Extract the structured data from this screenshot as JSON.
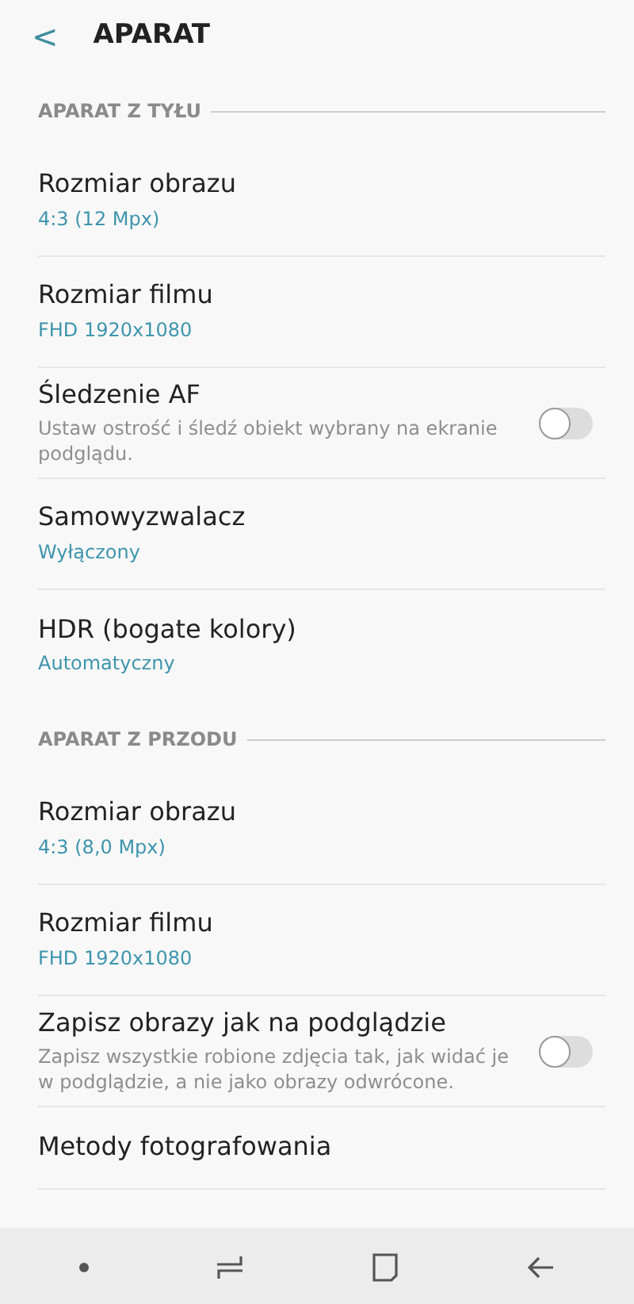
{
  "header": {
    "back": "<",
    "title": "APARAT"
  },
  "sections": [
    {
      "title": "APARAT Z TYŁU",
      "items": [
        {
          "kind": "value",
          "title": "Rozmiar obrazu",
          "value": "4:3 (12 Mpx)"
        },
        {
          "kind": "value",
          "title": "Rozmiar filmu",
          "value": "FHD 1920x1080"
        },
        {
          "kind": "toggle",
          "title": "Śledzenie AF",
          "description": "Ustaw ostrość i śledź obiekt wybrany na ekranie podglądu.",
          "on": false
        },
        {
          "kind": "value",
          "title": "Samowyzwalacz",
          "value": "Wyłączony"
        },
        {
          "kind": "value",
          "title": "HDR (bogate kolory)",
          "value": "Automatyczny"
        }
      ]
    },
    {
      "title": "APARAT Z PRZODU",
      "items": [
        {
          "kind": "value",
          "title": "Rozmiar obrazu",
          "value": "4:3 (8,0 Mpx)"
        },
        {
          "kind": "value",
          "title": "Rozmiar filmu",
          "value": "FHD 1920x1080"
        },
        {
          "kind": "toggle",
          "title": "Zapisz obrazy jak na podglądzie",
          "description": "Zapisz wszystkie robione zdjęcia tak, jak widać je w podglądzie, a nie jako obrazy odwrócone.",
          "on": false
        },
        {
          "kind": "plain",
          "title": "Metody fotografowania"
        }
      ]
    }
  ]
}
